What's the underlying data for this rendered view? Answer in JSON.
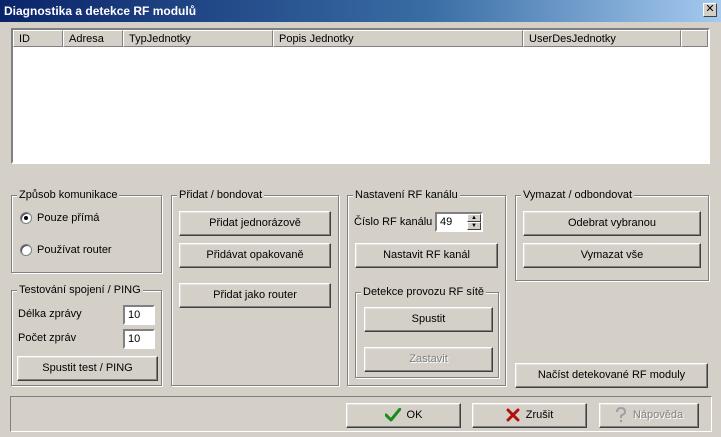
{
  "window": {
    "title": "Diagnostika a detekce RF modulů",
    "close_glyph": "✕"
  },
  "table": {
    "columns": [
      "ID",
      "Adresa",
      "TypJednotky",
      "Popis Jednotky",
      "UserDesJednotky",
      ""
    ],
    "rows": []
  },
  "communication": {
    "legend": "Způsob komunikace",
    "options": [
      {
        "label": "Pouze přímá",
        "checked": true
      },
      {
        "label": "Používat router",
        "checked": false
      }
    ]
  },
  "ping": {
    "legend": "Testování spojení / PING",
    "length_label": "Délka zprávy",
    "length_value": "10",
    "count_label": "Počet zpráv",
    "count_value": "10",
    "test_button": "Spustit test / PING"
  },
  "bond": {
    "legend": "Přidat / bondovat",
    "once_button": "Přidat jednorázově",
    "repeat_button": "Přidávat opakovaně",
    "router_button": "Přidat jako router"
  },
  "channel": {
    "legend": "Nastavení RF kanálu",
    "number_label": "Číslo RF kanálu",
    "number_value": "49",
    "set_button": "Nastavit RF kanál",
    "detect": {
      "legend": "Detekce provozu RF sítě",
      "start_button": "Spustit",
      "stop_button": "Zastavit"
    }
  },
  "remove": {
    "legend": "Vymazat / odbondovat",
    "selected_button": "Odebrat vybranou",
    "all_button": "Vymazat vše"
  },
  "load_button": "Načíst detekované RF moduly",
  "footer": {
    "ok_label": "OK",
    "cancel_label": "Zrušit",
    "help_label": "Nápověda"
  },
  "icons": {
    "ok": "check-icon",
    "cancel": "x-icon",
    "help": "help-icon"
  },
  "colors": {
    "ok_check": "#1a8c1a",
    "cancel_x": "#b01010",
    "title_bar": "#0a246a"
  }
}
